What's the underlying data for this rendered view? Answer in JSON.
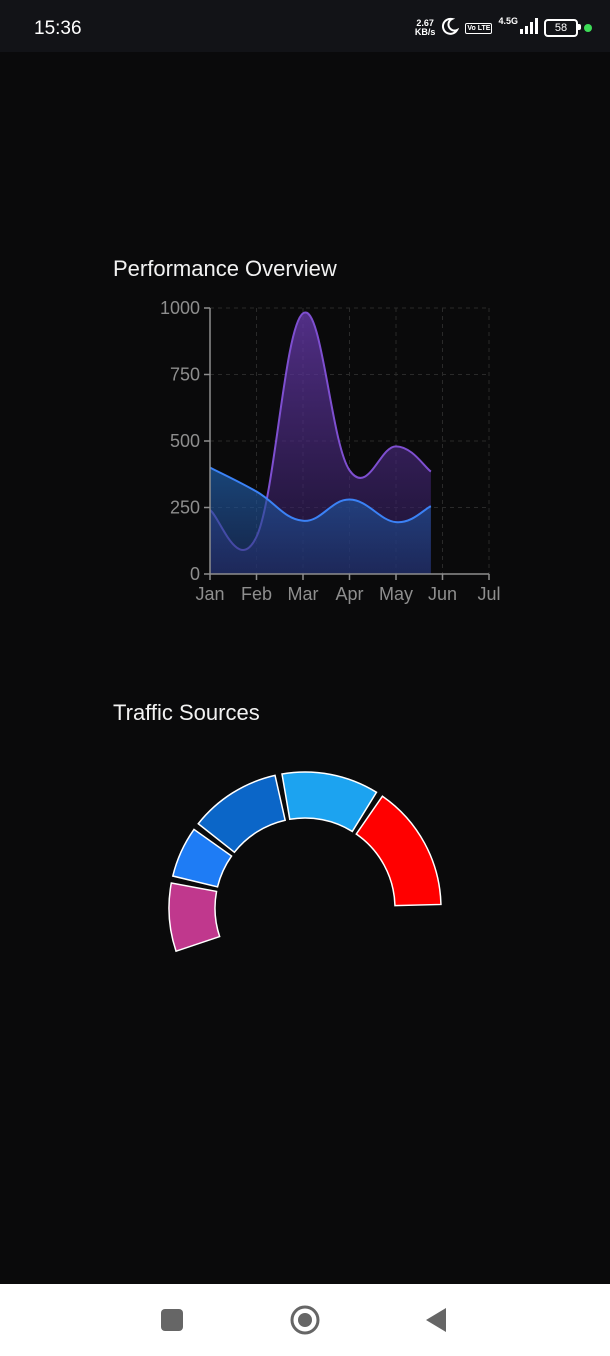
{
  "status_bar": {
    "time": "15:36",
    "net_speed_value": "2.67",
    "net_speed_unit": "KB/s",
    "volte": "Vo LTE",
    "network": "4.5G",
    "battery": "58",
    "icons": [
      "moon-icon",
      "volte-icon",
      "signal-icon",
      "battery-icon",
      "privacy-dot-icon"
    ]
  },
  "performance": {
    "title": "Performance Overview"
  },
  "traffic": {
    "title": "Traffic Sources"
  },
  "colors": {
    "background": "#0a0a0b",
    "series_purple": "#7e4fd0",
    "series_blue": "#3b82f6",
    "seg_pink": "#c0388d",
    "seg_blue": "#1e7cf5",
    "seg_darkblue": "#0b66c8",
    "seg_lightblue": "#1ca3f0",
    "seg_red": "#ff0000"
  },
  "chart_data": [
    {
      "type": "area",
      "title": "Performance Overview",
      "categories": [
        "Jan",
        "Feb",
        "Mar",
        "Apr",
        "May",
        "Jun",
        "Jul"
      ],
      "ylim": [
        0,
        1000
      ],
      "yticks": [
        0,
        250,
        500,
        750,
        1000
      ],
      "grid": true,
      "series": [
        {
          "values": [
            240,
            140,
            980,
            390,
            480,
            385
          ],
          "color": "#7e4fd0"
        },
        {
          "values": [
            400,
            310,
            200,
            280,
            195,
            255
          ],
          "color": "#3b82f6"
        }
      ]
    },
    {
      "type": "pie",
      "title": "Traffic Sources",
      "style": "half-donut",
      "slices": [
        {
          "value": 13,
          "color": "#c0388d"
        },
        {
          "value": 10,
          "color": "#1e7cf5"
        },
        {
          "value": 17,
          "color": "#0b66c8"
        },
        {
          "value": 18,
          "color": "#1ca3f0"
        },
        {
          "value": 23,
          "color": "#ff0000"
        }
      ]
    }
  ],
  "nav_bar": {
    "buttons": [
      "recents-button",
      "home-button",
      "back-button"
    ]
  }
}
